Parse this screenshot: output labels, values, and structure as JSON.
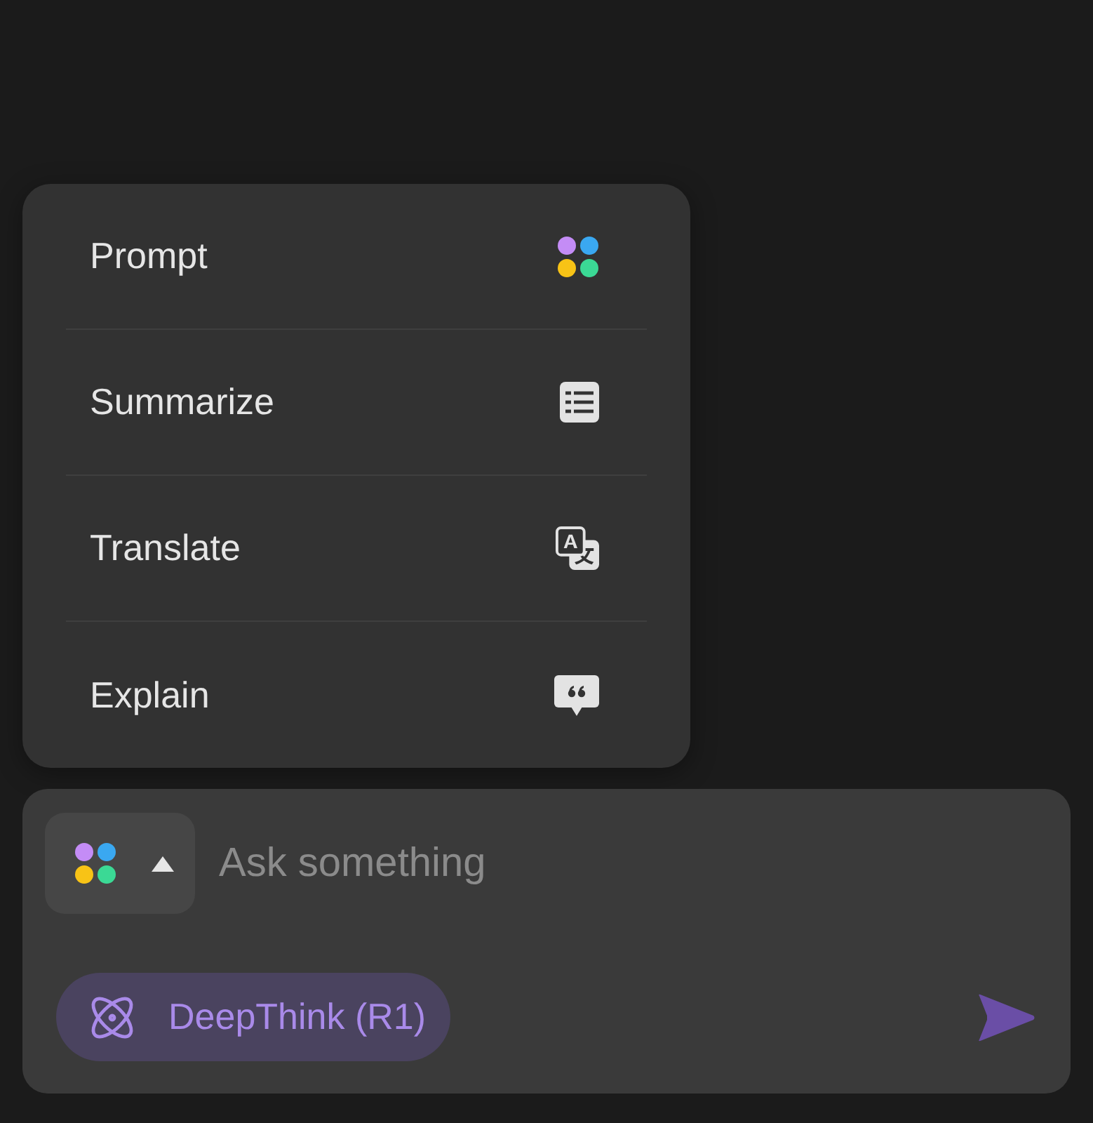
{
  "menu": {
    "items": [
      {
        "label": "Prompt",
        "kind": "prompt"
      },
      {
        "label": "Summarize",
        "kind": "summarize"
      },
      {
        "label": "Translate",
        "kind": "translate"
      },
      {
        "label": "Explain",
        "kind": "explain"
      }
    ]
  },
  "composer": {
    "mode_button": {
      "expanded": true
    },
    "input": {
      "placeholder": "Ask something"
    },
    "deepthink": {
      "label": "DeepThink (R1)",
      "on": true
    },
    "send_button": {
      "disabled": true
    }
  }
}
